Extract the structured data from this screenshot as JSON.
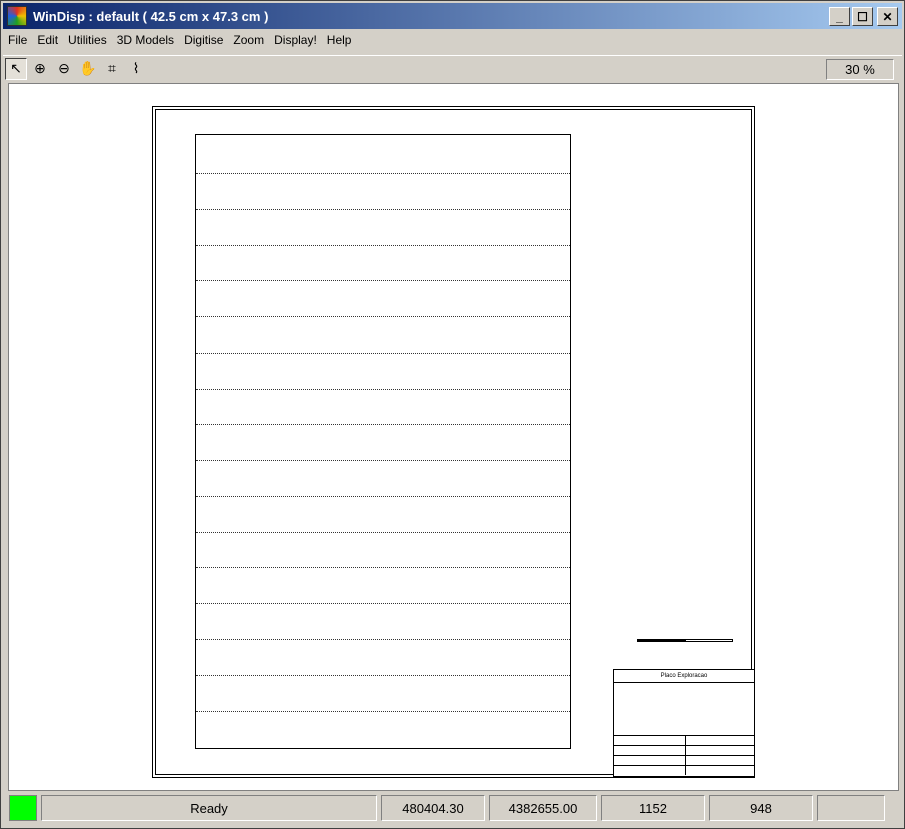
{
  "window": {
    "title": "WinDisp : default ( 42.5 cm x 47.3 cm )"
  },
  "menu": [
    "File",
    "Edit",
    "Utilities",
    "3D Models",
    "Digitise",
    "Zoom",
    "Display!",
    "Help"
  ],
  "toolbar": {
    "tools": [
      {
        "name": "pointer-icon",
        "glyph": "↖"
      },
      {
        "name": "zoom-in-icon",
        "glyph": "⊕"
      },
      {
        "name": "zoom-out-icon",
        "glyph": "⊖"
      },
      {
        "name": "pan-hand-icon",
        "glyph": "✋"
      },
      {
        "name": "grid-icon",
        "glyph": "⌗"
      },
      {
        "name": "profile-chart-icon",
        "glyph": "⌇"
      }
    ],
    "zoom_level": "30 %"
  },
  "map": {
    "title_block_heading": "Placo Exploracao"
  },
  "status": {
    "state": "Ready",
    "x": "480404.30",
    "y": "4382655.00",
    "col": "1152",
    "row": "948",
    "extra": ""
  }
}
